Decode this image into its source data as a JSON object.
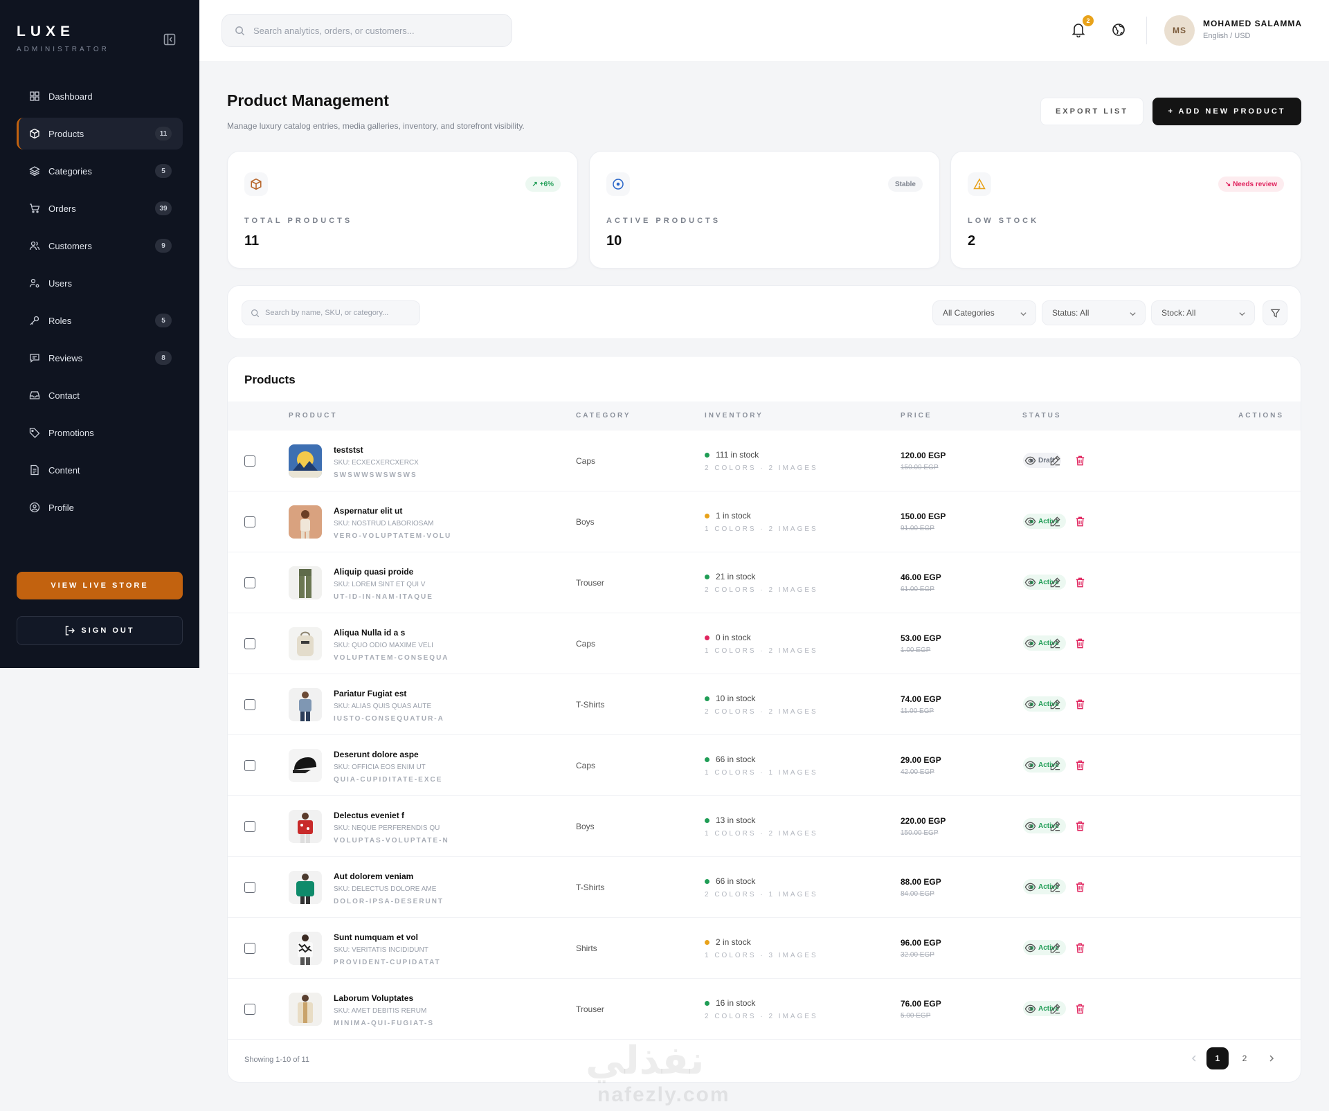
{
  "sidebar": {
    "brand": "LUXE",
    "brand_sub": "ADMINISTRATOR",
    "items": [
      {
        "label": "Dashboard",
        "count": null,
        "icon": "grid-icon"
      },
      {
        "label": "Products",
        "count": "11",
        "icon": "box-icon",
        "active": true
      },
      {
        "label": "Categories",
        "count": "5",
        "icon": "layers-icon"
      },
      {
        "label": "Orders",
        "count": "39",
        "icon": "cart-icon"
      },
      {
        "label": "Customers",
        "count": "9",
        "icon": "users-icon"
      },
      {
        "label": "Users",
        "count": null,
        "icon": "user-cog-icon"
      },
      {
        "label": "Roles",
        "count": "5",
        "icon": "key-icon"
      },
      {
        "label": "Reviews",
        "count": "8",
        "icon": "message-icon"
      },
      {
        "label": "Contact",
        "count": null,
        "icon": "inbox-icon"
      },
      {
        "label": "Promotions",
        "count": null,
        "icon": "tag-icon"
      },
      {
        "label": "Content",
        "count": null,
        "icon": "file-icon"
      },
      {
        "label": "Profile",
        "count": null,
        "icon": "user-circle-icon"
      }
    ],
    "view_store": "VIEW LIVE STORE",
    "sign_out": "SIGN OUT"
  },
  "topbar": {
    "search_placeholder": "Search analytics, orders, or customers...",
    "notifications": "2",
    "avatar_initials": "MS",
    "user_name": "MOHAMED SALAMMA",
    "locale": "English / USD"
  },
  "header": {
    "title": "Product Management",
    "subtitle": "Manage luxury catalog entries, media galleries, inventory, and storefront visibility.",
    "export": "EXPORT LIST",
    "add": "+ ADD NEW PRODUCT"
  },
  "stats": [
    {
      "label": "TOTAL PRODUCTS",
      "value": "11",
      "pill": "↗ +6%",
      "icon": "box-icon"
    },
    {
      "label": "ACTIVE PRODUCTS",
      "value": "10",
      "pill": "Stable",
      "icon": "target-icon"
    },
    {
      "label": "LOW STOCK",
      "value": "2",
      "pill": "↘ Needs review",
      "icon": "warning-icon"
    }
  ],
  "filters": {
    "search_placeholder": "Search by name, SKU, or category...",
    "category": "All Categories",
    "status": "Status: All",
    "stock": "Stock: All"
  },
  "table": {
    "title": "Products",
    "headers": {
      "product": "PRODUCT",
      "category": "CATEGORY",
      "inventory": "INVENTORY",
      "price": "PRICE",
      "status": "STATUS",
      "actions": "ACTIONS"
    },
    "rows": [
      {
        "name": "teststst",
        "sku": "SKU: ECXECXERCXERCX",
        "slug": "SWSWWSWSWSWS",
        "category": "Caps",
        "stock": "111 in stock",
        "stock_level": "ok",
        "media": "2 COLORS · 2 IMAGES",
        "price": "120.00 EGP",
        "old_price": "150.00 EGP",
        "status": "Draft"
      },
      {
        "name": "Aspernatur elit ut",
        "sku": "SKU: NOSTRUD LABORIOSAM",
        "slug": "VERO-VOLUPTATEM-VOLU",
        "category": "Boys",
        "stock": "1 in stock",
        "stock_level": "low",
        "media": "1 COLORS · 2 IMAGES",
        "price": "150.00 EGP",
        "old_price": "91.00 EGP",
        "status": "Active"
      },
      {
        "name": "Aliquip quasi proide",
        "sku": "SKU: LOREM SINT ET QUI V",
        "slug": "UT-ID-IN-NAM-ITAQUE",
        "category": "Trouser",
        "stock": "21 in stock",
        "stock_level": "ok",
        "media": "2 COLORS · 2 IMAGES",
        "price": "46.00 EGP",
        "old_price": "61.00 EGP",
        "status": "Active"
      },
      {
        "name": "Aliqua Nulla id a s",
        "sku": "SKU: QUO ODIO MAXIME VELI",
        "slug": "VOLUPTATEM-CONSEQUA",
        "category": "Caps",
        "stock": "0 in stock",
        "stock_level": "out",
        "media": "1 COLORS · 2 IMAGES",
        "price": "53.00 EGP",
        "old_price": "1.00 EGP",
        "status": "Active"
      },
      {
        "name": "Pariatur Fugiat est",
        "sku": "SKU: ALIAS QUIS QUAS AUTE",
        "slug": "IUSTO-CONSEQUATUR-A",
        "category": "T-Shirts",
        "stock": "10 in stock",
        "stock_level": "ok",
        "media": "2 COLORS · 2 IMAGES",
        "price": "74.00 EGP",
        "old_price": "11.00 EGP",
        "status": "Active"
      },
      {
        "name": "Deserunt dolore aspe",
        "sku": "SKU: OFFICIA EOS ENIM UT",
        "slug": "QUIA-CUPIDITATE-EXCE",
        "category": "Caps",
        "stock": "66 in stock",
        "stock_level": "ok",
        "media": "1 COLORS · 1 IMAGES",
        "price": "29.00 EGP",
        "old_price": "42.00 EGP",
        "status": "Active"
      },
      {
        "name": "Delectus eveniet f",
        "sku": "SKU: NEQUE PERFERENDIS QU",
        "slug": "VOLUPTAS-VOLUPTATE-N",
        "category": "Boys",
        "stock": "13 in stock",
        "stock_level": "ok",
        "media": "1 COLORS · 2 IMAGES",
        "price": "220.00 EGP",
        "old_price": "150.00 EGP",
        "status": "Active"
      },
      {
        "name": "Aut dolorem veniam",
        "sku": "SKU: DELECTUS DOLORE AME",
        "slug": "DOLOR-IPSA-DESERUNT",
        "category": "T-Shirts",
        "stock": "66 in stock",
        "stock_level": "ok",
        "media": "2 COLORS · 1 IMAGES",
        "price": "88.00 EGP",
        "old_price": "84.00 EGP",
        "status": "Active"
      },
      {
        "name": "Sunt numquam et vol",
        "sku": "SKU: VERITATIS INCIDIDUNT",
        "slug": "PROVIDENT-CUPIDATAT",
        "category": "Shirts",
        "stock": "2 in stock",
        "stock_level": "low",
        "media": "1 COLORS · 3 IMAGES",
        "price": "96.00 EGP",
        "old_price": "32.00 EGP",
        "status": "Active"
      },
      {
        "name": "Laborum Voluptates",
        "sku": "SKU: AMET DEBITIS RERUM",
        "slug": "MINIMA-QUI-FUGIAT-S",
        "category": "Trouser",
        "stock": "16 in stock",
        "stock_level": "ok",
        "media": "2 COLORS · 2 IMAGES",
        "price": "76.00 EGP",
        "old_price": "5.00 EGP",
        "status": "Active"
      }
    ],
    "showing": "Showing 1-10 of 11",
    "pages": [
      "1",
      "2"
    ],
    "current_page": "1"
  },
  "watermark": {
    "arabic": "نفذلي",
    "latin": "nafezly.com"
  },
  "colors": {
    "accent": "#c2620f",
    "sidebar_bg": "#0f1420",
    "ok": "#1f9d55",
    "low": "#e8a21a",
    "out": "#e0245e",
    "delete": "#e0245e"
  }
}
